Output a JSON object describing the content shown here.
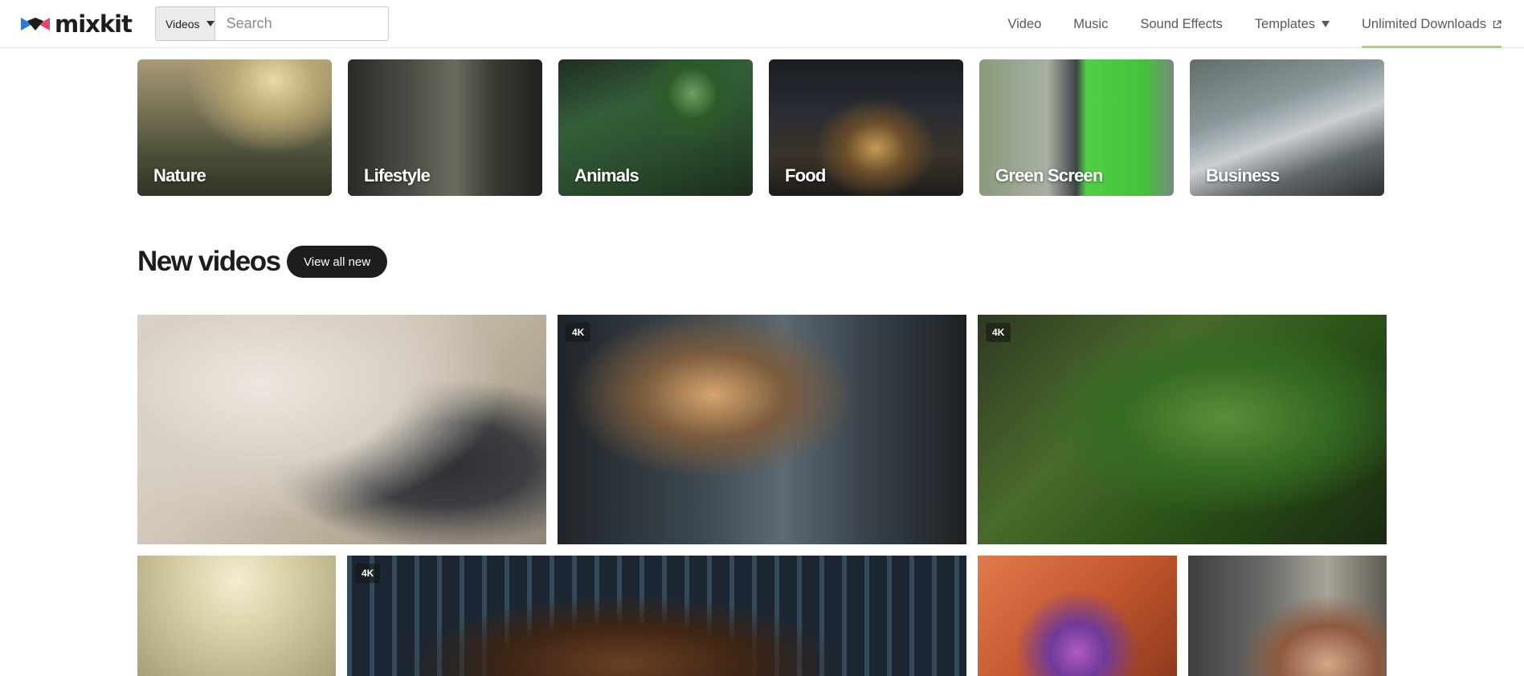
{
  "header": {
    "logo_text": "mixkit",
    "search": {
      "category_selected": "Videos",
      "placeholder": "Search"
    },
    "nav": [
      {
        "label": "Video"
      },
      {
        "label": "Music"
      },
      {
        "label": "Sound Effects"
      },
      {
        "label": "Templates"
      },
      {
        "label": "Unlimited Downloads"
      }
    ]
  },
  "categories": [
    {
      "label": "Nature"
    },
    {
      "label": "Lifestyle"
    },
    {
      "label": "Animals"
    },
    {
      "label": "Food"
    },
    {
      "label": "Green Screen"
    },
    {
      "label": "Business"
    }
  ],
  "new_videos": {
    "title": "New videos",
    "view_all_label": "View all new",
    "videos": [
      {
        "badge": ""
      },
      {
        "badge": "4K"
      },
      {
        "badge": "4K"
      },
      {
        "badge": ""
      },
      {
        "badge": "4K"
      },
      {
        "badge": ""
      },
      {
        "badge": ""
      }
    ]
  },
  "colors": {
    "accent_underline": "#9bd97c",
    "dark_button": "#1d1d1d",
    "logo_pink": "#e8456b",
    "logo_blue": "#2a7ad6"
  }
}
